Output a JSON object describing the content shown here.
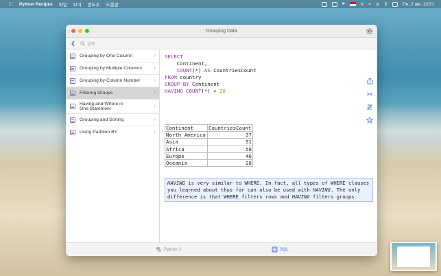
{
  "menubar": {
    "app_name": "Python Recipes",
    "menus": [
      "파일",
      "보기",
      "윈도우",
      "도움말"
    ],
    "clock": "Пн, 2 авг.  13:51"
  },
  "window": {
    "title": "Grouping Data"
  },
  "search": {
    "placeholder": "검색"
  },
  "sidebar": {
    "items": [
      {
        "label": "Grouping by One Column"
      },
      {
        "label": "Grouping by Multiple Columns"
      },
      {
        "label": "Grouping by Column Number"
      },
      {
        "label": "Filtering Groups"
      },
      {
        "label": "Having and Where in One Statement"
      },
      {
        "label": "Grouping and Sorting"
      },
      {
        "label": "Using Partition BY"
      }
    ],
    "active_index": 3
  },
  "sql": {
    "lines": [
      "SELECT",
      "    Continent,",
      "    COUNT(*) AS CountriesCount",
      "FROM country",
      "GROUP BY Continent",
      "HAVING COUNT(*) > 20"
    ]
  },
  "result": {
    "headers": [
      "Continent",
      "CountriesCount"
    ],
    "rows": [
      [
        "North America",
        "37"
      ],
      [
        "Asia",
        "51"
      ],
      [
        "Africa",
        "58"
      ],
      [
        "Europe",
        "46"
      ],
      [
        "Oceania",
        "28"
      ]
    ]
  },
  "note": {
    "t1": "HAVING",
    "t2": " is very similar to WHERE. In fact, all types of WHERE clauses you learned about thus far can also be used with ",
    "t3": "HAVING",
    "t4": ". The only difference is that WHERE filters rows and ",
    "t5": "HAVING",
    "t6": " filters groups."
  },
  "tabs": {
    "python": "Python 3",
    "sql": "SQL"
  },
  "colors": {
    "accent": "#3b73e0",
    "keyword": "#9b2fa6",
    "number": "#b8860b",
    "selected_row": "#d5d5d5",
    "note_bg": "#eaf1fd"
  }
}
